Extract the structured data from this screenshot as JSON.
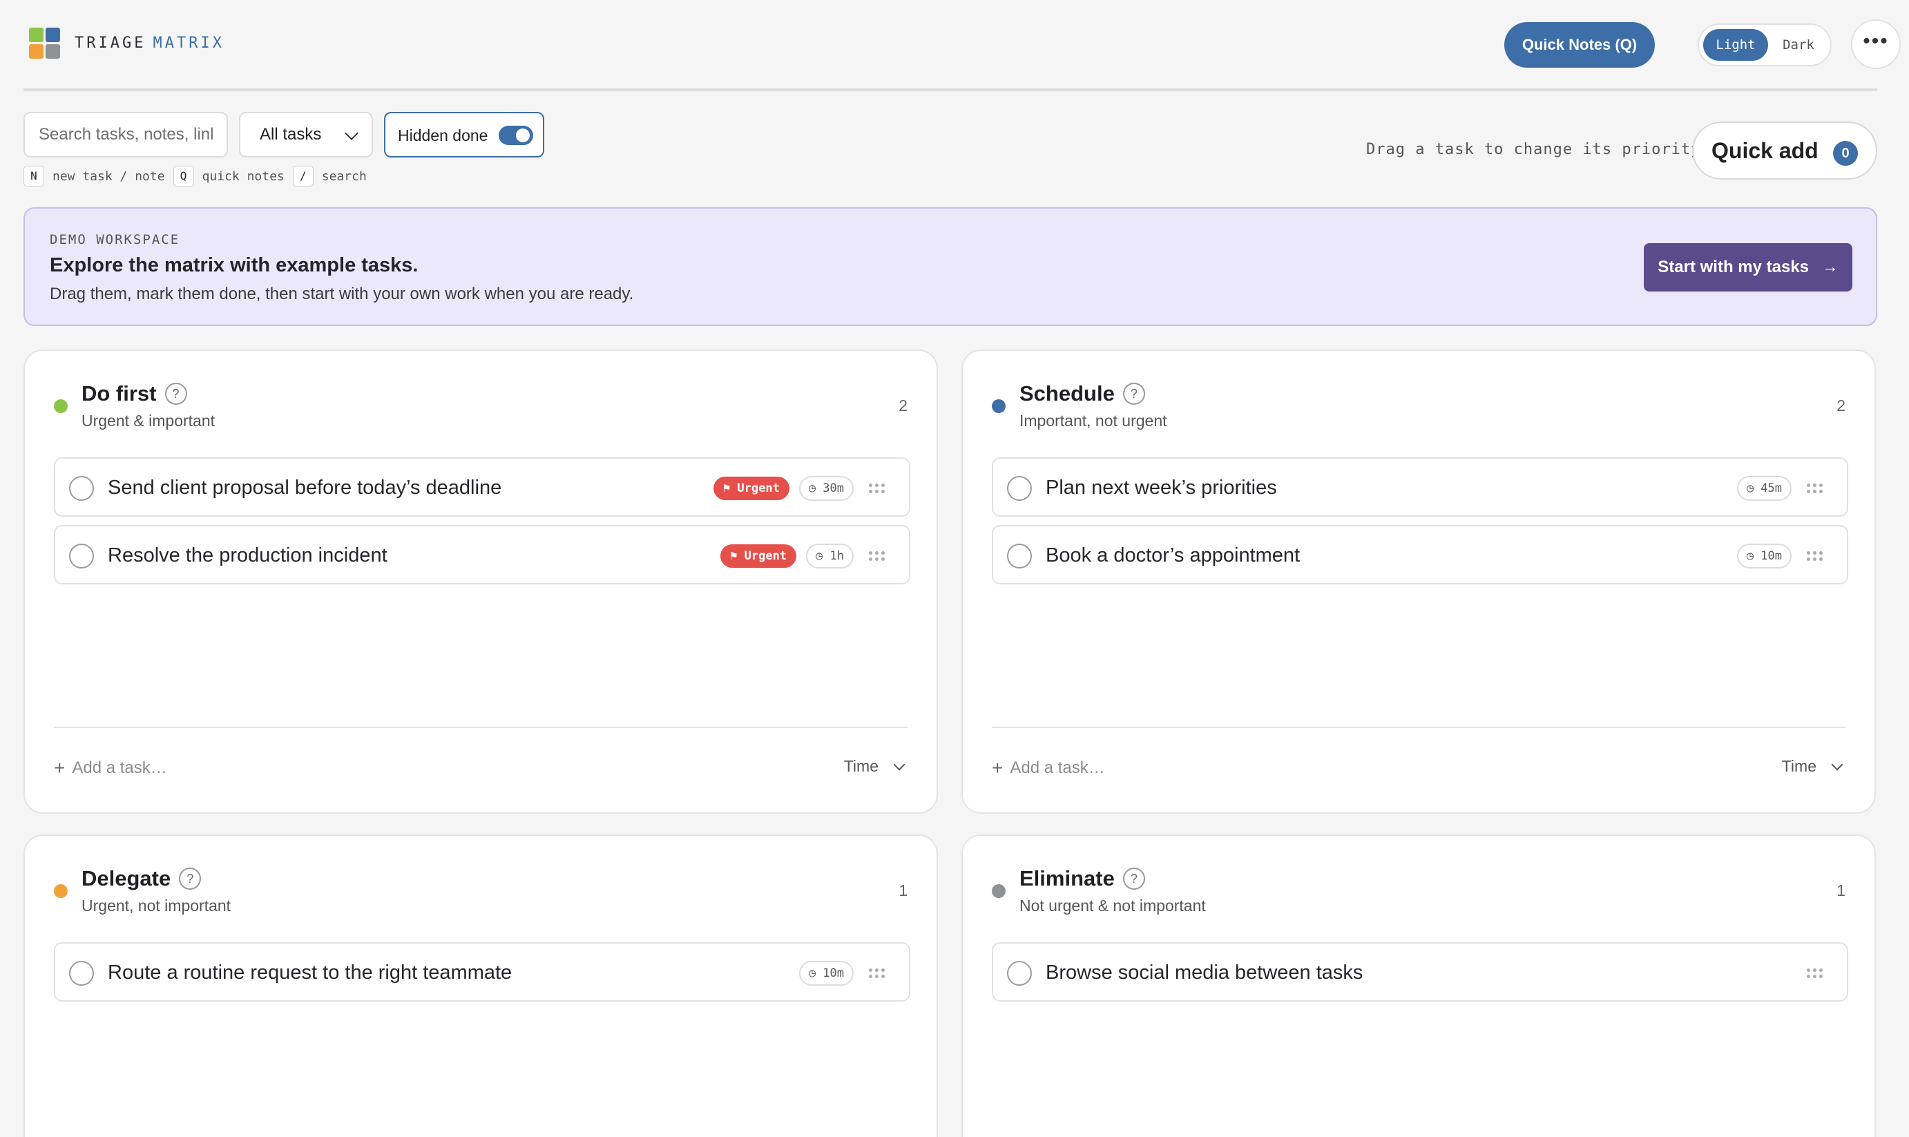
{
  "app": {
    "brand_part1": "TRIAGE",
    "brand_part2": "MATRIX",
    "quick_notes_label": "Quick Notes (Q)",
    "theme": {
      "light": "Light",
      "dark": "Dark",
      "selected": "Light"
    },
    "more_icon": "more-dots-icon"
  },
  "toolbar": {
    "search_placeholder": "Search tasks, notes, links",
    "filter_value": "All tasks",
    "hidden_done_label": "Hidden done",
    "hidden_done_on": true,
    "shortcuts": [
      {
        "key": "N",
        "label": "new task / note"
      },
      {
        "key": "Q",
        "label": "quick notes"
      },
      {
        "key": "/",
        "label": "search"
      }
    ],
    "drag_hint": "Drag a task to change its priority",
    "quick_add_label": "Quick add",
    "quick_add_count": "0"
  },
  "banner": {
    "tag": "DEMO WORKSPACE",
    "title": "Explore the matrix with example tasks.",
    "subtitle": "Drag them, mark them done, then start with your own work when you are ready.",
    "cta_label": "Start with my tasks",
    "cta_arrow": "→"
  },
  "colors": {
    "accent": "#3e6ea8",
    "do_first": "#8cc447",
    "schedule": "#3e6ea8",
    "delegate": "#f2a03a",
    "eliminate": "#8e9294",
    "urgent": "#e6504a",
    "banner_bg": "#ece8fb",
    "banner_cta": "#5b4b8a"
  },
  "quadrants": {
    "do_first": {
      "title": "Do first",
      "help": "?",
      "subtitle": "Urgent & important",
      "count": "2",
      "add_placeholder": "Add a task…",
      "sort_label": "Time",
      "tasks": [
        {
          "text": "Send client proposal before today’s deadline",
          "urgent": "⚑ Urgent",
          "time": "◷ 30m"
        },
        {
          "text": "Resolve the production incident",
          "urgent": "⚑ Urgent",
          "time": "◷ 1h"
        }
      ]
    },
    "schedule": {
      "title": "Schedule",
      "help": "?",
      "subtitle": "Important, not urgent",
      "count": "2",
      "add_placeholder": "Add a task…",
      "sort_label": "Time",
      "tasks": [
        {
          "text": "Plan next week’s priorities",
          "time": "◷ 45m"
        },
        {
          "text": "Book a doctor’s appointment",
          "time": "◷ 10m"
        }
      ]
    },
    "delegate": {
      "title": "Delegate",
      "help": "?",
      "subtitle": "Urgent, not important",
      "count": "1",
      "tasks": [
        {
          "text": "Route a routine request to the right teammate",
          "time": "◷ 10m"
        }
      ]
    },
    "eliminate": {
      "title": "Eliminate",
      "help": "?",
      "subtitle": "Not urgent & not important",
      "count": "1",
      "tasks": [
        {
          "text": "Browse social media between tasks"
        }
      ]
    }
  }
}
